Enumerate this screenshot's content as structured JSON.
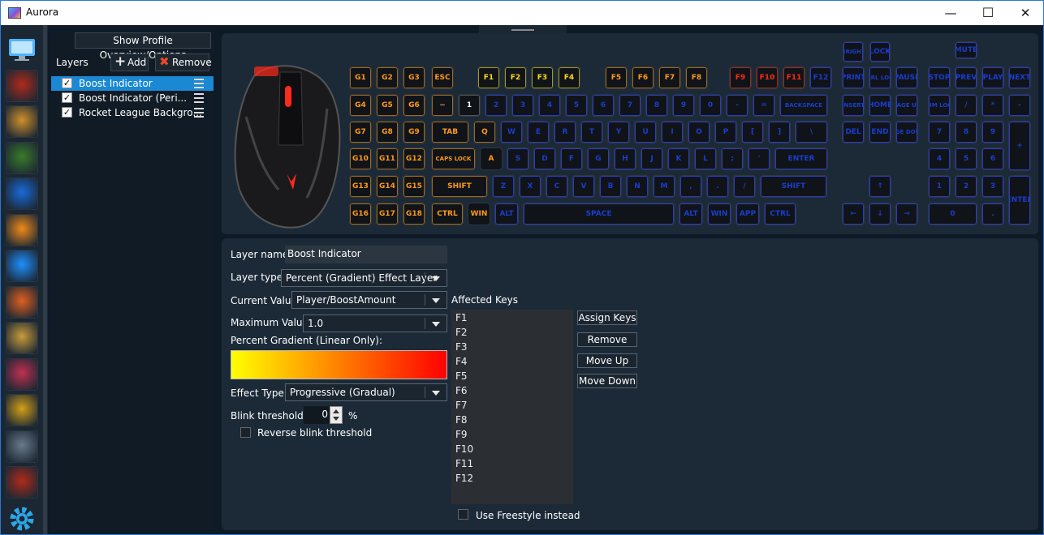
{
  "window": {
    "title": "Aurora"
  },
  "window_controls": {
    "minimize": "—",
    "maximize": "☐",
    "close": "✕"
  },
  "sidebar": {
    "apps": [
      {
        "name": "desktop-icon",
        "color": "#4fb3ff"
      },
      {
        "name": "dota2-icon",
        "color": "#b02a1a"
      },
      {
        "name": "csgo-icon",
        "color": "#d0902a"
      },
      {
        "name": "gta5-icon",
        "color": "#3a7a2a"
      },
      {
        "name": "rocket-league-icon",
        "color": "#1a6ad8"
      },
      {
        "name": "overwatch-icon",
        "color": "#f08a1a"
      },
      {
        "name": "payday2-icon",
        "color": "#1e90ff"
      },
      {
        "name": "the-division-icon",
        "color": "#e06020"
      },
      {
        "name": "league-of-legends-icon",
        "color": "#c89b3c"
      },
      {
        "name": "hotline-miami-icon",
        "color": "#c03050"
      },
      {
        "name": "deus-ex-icon",
        "color": "#d4a017"
      },
      {
        "name": "battlefield-soldier-icon",
        "color": "#6a7a8a"
      },
      {
        "name": "division-red-icon",
        "color": "#b02a1a"
      },
      {
        "name": "settings-gear-icon",
        "color": "#2da6e8"
      }
    ]
  },
  "layers_panel": {
    "overview_button": "Show Profile Overview/Options",
    "label": "Layers",
    "add_button": "Add",
    "add_icon": "+",
    "remove_button": "Remove",
    "remove_icon": "✖",
    "layers": [
      {
        "name": "Boost Indicator",
        "checked": true,
        "selected": true
      },
      {
        "name": "Boost Indicator (Peri...",
        "checked": true,
        "selected": false
      },
      {
        "name": "Rocket League Backgro...",
        "checked": true,
        "selected": false
      }
    ]
  },
  "keyboard": {
    "g_keys": [
      [
        "G1",
        "G2",
        "G3"
      ],
      [
        "G4",
        "G5",
        "G6"
      ],
      [
        "G7",
        "G8",
        "G9"
      ],
      [
        "G10",
        "G11",
        "G12"
      ],
      [
        "G13",
        "G14",
        "G15"
      ],
      [
        "G16",
        "G17",
        "G18"
      ]
    ],
    "row_fn": [
      {
        "t": "ESC",
        "c": "o"
      },
      {
        "t": "F1",
        "c": "y"
      },
      {
        "t": "F2",
        "c": "y"
      },
      {
        "t": "F3",
        "c": "y"
      },
      {
        "t": "F4",
        "c": "y"
      },
      {
        "t": "F5",
        "c": "o"
      },
      {
        "t": "F6",
        "c": "o"
      },
      {
        "t": "F7",
        "c": "o"
      },
      {
        "t": "F8",
        "c": "o"
      },
      {
        "t": "F9",
        "c": "r"
      },
      {
        "t": "F10",
        "c": "r"
      },
      {
        "t": "F11",
        "c": "r"
      },
      {
        "t": "F12",
        "c": "b"
      }
    ],
    "row_num": [
      {
        "t": "~",
        "c": "o"
      },
      {
        "t": "1",
        "c": "w"
      },
      {
        "t": "2",
        "c": "b"
      },
      {
        "t": "3",
        "c": "b"
      },
      {
        "t": "4",
        "c": "b"
      },
      {
        "t": "5",
        "c": "b"
      },
      {
        "t": "6",
        "c": "b"
      },
      {
        "t": "7",
        "c": "b"
      },
      {
        "t": "8",
        "c": "b"
      },
      {
        "t": "9",
        "c": "b"
      },
      {
        "t": "0",
        "c": "b"
      },
      {
        "t": "-",
        "c": "b"
      },
      {
        "t": "=",
        "c": "b"
      },
      {
        "t": "BACKSPACE",
        "c": "b"
      }
    ],
    "row_tab": [
      {
        "t": "TAB",
        "c": "o"
      },
      {
        "t": "Q",
        "c": "o"
      },
      {
        "t": "W",
        "c": "b"
      },
      {
        "t": "E",
        "c": "b"
      },
      {
        "t": "R",
        "c": "b"
      },
      {
        "t": "T",
        "c": "b"
      },
      {
        "t": "Y",
        "c": "b"
      },
      {
        "t": "U",
        "c": "b"
      },
      {
        "t": "I",
        "c": "b"
      },
      {
        "t": "O",
        "c": "b"
      },
      {
        "t": "P",
        "c": "b"
      },
      {
        "t": "[",
        "c": "b"
      },
      {
        "t": "]",
        "c": "b"
      },
      {
        "t": "\\",
        "c": "b"
      }
    ],
    "row_caps": [
      {
        "t": "CAPS LOCK",
        "c": "o"
      },
      {
        "t": "A",
        "c": "d"
      },
      {
        "t": "S",
        "c": "b"
      },
      {
        "t": "D",
        "c": "b"
      },
      {
        "t": "F",
        "c": "b"
      },
      {
        "t": "G",
        "c": "b"
      },
      {
        "t": "H",
        "c": "b"
      },
      {
        "t": "J",
        "c": "b"
      },
      {
        "t": "K",
        "c": "b"
      },
      {
        "t": "L",
        "c": "b"
      },
      {
        "t": ";",
        "c": "b"
      },
      {
        "t": "'",
        "c": "b"
      },
      {
        "t": "ENTER",
        "c": "b"
      }
    ],
    "row_shift": [
      {
        "t": "SHIFT",
        "c": "o"
      },
      {
        "t": "Z",
        "c": "b"
      },
      {
        "t": "X",
        "c": "b"
      },
      {
        "t": "C",
        "c": "b"
      },
      {
        "t": "V",
        "c": "b"
      },
      {
        "t": "B",
        "c": "b"
      },
      {
        "t": "N",
        "c": "b"
      },
      {
        "t": "M",
        "c": "b"
      },
      {
        "t": ",",
        "c": "b"
      },
      {
        "t": ".",
        "c": "b"
      },
      {
        "t": "/",
        "c": "b"
      },
      {
        "t": "SHIFT",
        "c": "b"
      }
    ],
    "row_ctrl": [
      {
        "t": "CTRL",
        "c": "o"
      },
      {
        "t": "WIN",
        "c": "d"
      },
      {
        "t": "ALT",
        "c": "b"
      },
      {
        "t": "SPACE",
        "c": "b"
      },
      {
        "t": "ALT",
        "c": "b"
      },
      {
        "t": "WIN",
        "c": "b"
      },
      {
        "t": "APP",
        "c": "b"
      },
      {
        "t": "CTRL",
        "c": "b"
      }
    ],
    "nav_top": [
      "BRIGHT",
      "LOCK",
      "MUTE"
    ],
    "nav_keys": [
      [
        "PRINT",
        "SCRL LOCK",
        "PAUSE"
      ],
      [
        "INSERT",
        "HOME",
        "PAGE UP"
      ],
      [
        "DEL",
        "END",
        "PAGE DOWN"
      ]
    ],
    "media_keys": [
      "STOP",
      "PREV",
      "PLAY",
      "NEXT"
    ],
    "arrow_keys": {
      "up": "↑",
      "left": "←",
      "down": "↓",
      "right": "→"
    },
    "numpad": [
      [
        "NUM LOCK",
        "/",
        "*",
        "-"
      ],
      [
        "7",
        "8",
        "9",
        "+"
      ],
      [
        "4",
        "5",
        "6"
      ],
      [
        "1",
        "2",
        "3",
        "ENTER"
      ],
      [
        "0",
        "."
      ]
    ]
  },
  "properties": {
    "layer_name_label": "Layer name:",
    "layer_name_value": "Boost Indicator",
    "layer_type_label": "Layer type:",
    "layer_type_value": "Percent (Gradient) Effect Layer",
    "current_value_label": "Current Value:",
    "current_value": "Player/BoostAmount",
    "maximum_value_label": "Maximum Value:",
    "maximum_value": "1.0",
    "gradient_label": "Percent Gradient (Linear Only):",
    "gradient_colors": [
      "#ffff00",
      "#ff0000"
    ],
    "effect_type_label": "Effect Type:",
    "effect_type_value": "Progressive (Gradual)",
    "blink_label": "Blink threshold:",
    "blink_value": "0",
    "blink_unit": "%",
    "reverse_blink_label": "Reverse blink threshold",
    "affected_keys_label": "Affected Keys",
    "affected_keys": [
      "F1",
      "F2",
      "F3",
      "F4",
      "F5",
      "F6",
      "F7",
      "F8",
      "F9",
      "F10",
      "F11",
      "F12"
    ],
    "assign_keys_button": "Assign Keys",
    "remove_button": "Remove",
    "move_up_button": "Move Up",
    "move_down_button": "Move Down",
    "freestyle_label": "Use Freestyle instead"
  }
}
